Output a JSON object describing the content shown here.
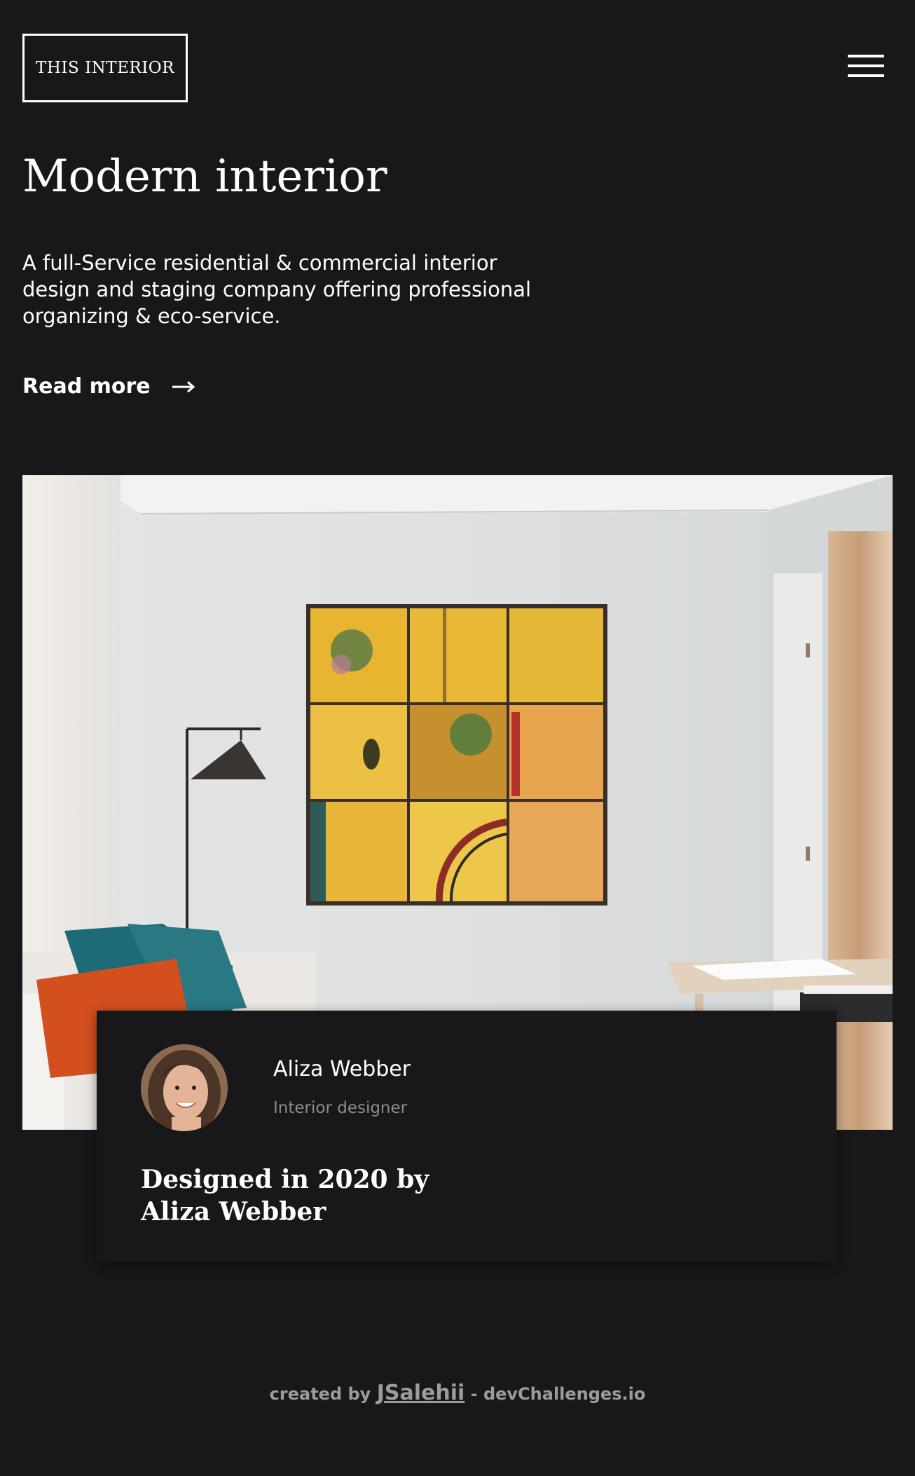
{
  "header": {
    "logo_text": "THIS INTERIOR",
    "menu_icon": "hamburger-menu-icon"
  },
  "hero": {
    "title": "Modern interior",
    "description": "A full-Service residential & commercial interior design and staging company offering professional organizing & eco-service.",
    "cta_label": "Read more",
    "cta_icon": "arrow-right-icon"
  },
  "photo": {
    "subject": "living room with yellow framed collage art"
  },
  "designer_card": {
    "name": "Aliza Webber",
    "role": "Interior designer",
    "caption": "Designed in 2020 by Aliza Webber"
  },
  "footer": {
    "prefix": "created by",
    "author_link": "JSalehii",
    "suffix": "- devChallenges.io"
  },
  "colors": {
    "background": "#18171a",
    "text": "#ffffff",
    "muted": "#8c8b8e",
    "footer": "#9c9b9e"
  }
}
